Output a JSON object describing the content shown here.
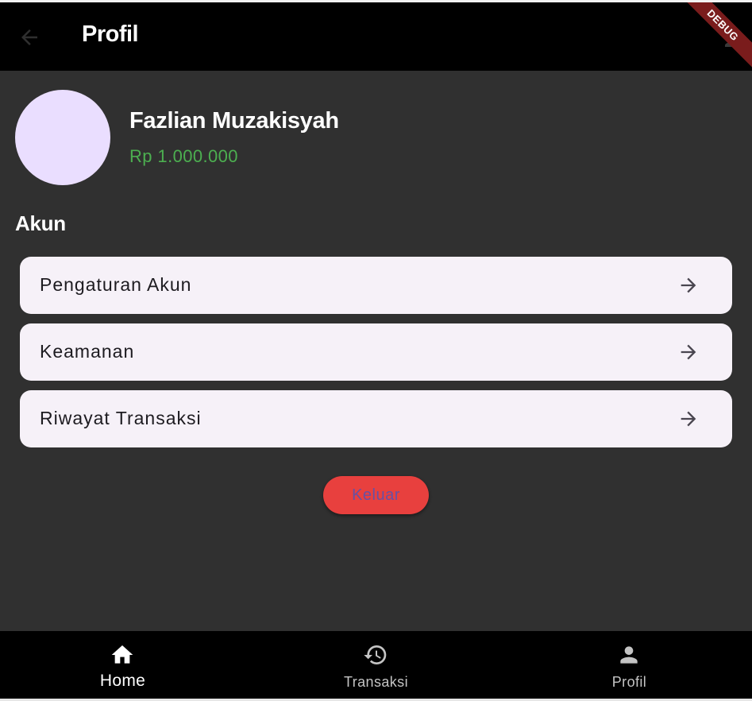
{
  "appbar": {
    "title": "Profil",
    "debug_banner": "DEBUG",
    "back_icon": "arrow-back-icon"
  },
  "profile": {
    "name": "Fazlian Muzakisyah",
    "balance": "Rp 1.000.000",
    "avatar_color": "#EADEFF",
    "balance_color": "#4CAF50"
  },
  "account_section": {
    "title": "Akun",
    "items": [
      {
        "label": "Pengaturan Akun",
        "icon": "arrow-forward-icon"
      },
      {
        "label": "Keamanan",
        "icon": "arrow-forward-icon"
      },
      {
        "label": "Riwayat Transaksi",
        "icon": "arrow-forward-icon"
      }
    ]
  },
  "logout": {
    "label": "Keluar",
    "background_color": "#E8403E",
    "text_color": "#6750A4"
  },
  "bottom_nav": {
    "items": [
      {
        "label": "Home",
        "icon": "home-icon",
        "active": true
      },
      {
        "label": "Transaksi",
        "icon": "history-icon",
        "active": false
      },
      {
        "label": "Profil",
        "icon": "person-icon",
        "active": false
      }
    ]
  }
}
